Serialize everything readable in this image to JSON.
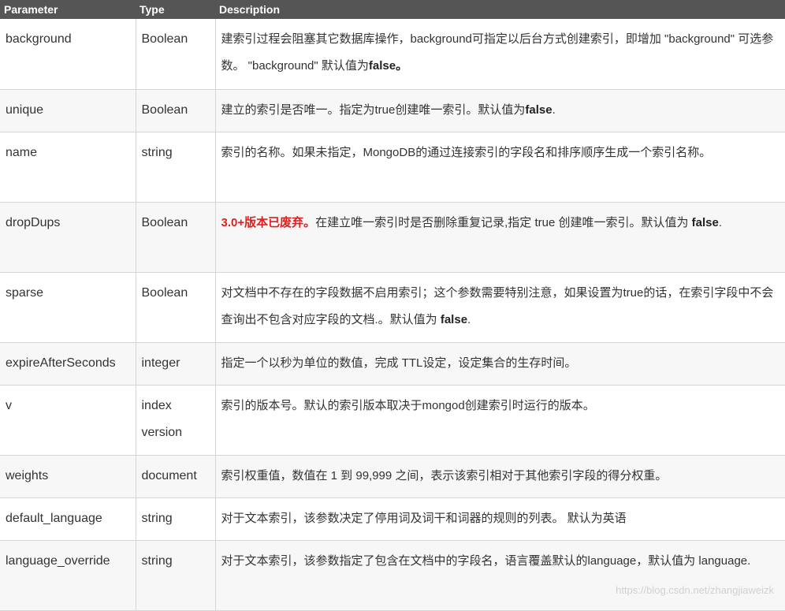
{
  "headers": {
    "parameter": "Parameter",
    "type": "Type",
    "description": "Description"
  },
  "rows": [
    {
      "param": "background",
      "type": "Boolean",
      "desc_a": "建索引过程会阻塞其它数据库操作，background可指定以后台方式创建索引，即增加 \"background\" 可选参数。 \"background\" 默认值为",
      "desc_bold": "false。",
      "desc_b": ""
    },
    {
      "param": "unique",
      "type": "Boolean",
      "desc_a": "建立的索引是否唯一。指定为true创建唯一索引。默认值为",
      "desc_bold": "false",
      "desc_b": "."
    },
    {
      "param": "name",
      "type": "string",
      "desc_a": "索引的名称。如果未指定，MongoDB的通过连接索引的字段名和排序顺序生成一个索引名称。",
      "desc_bold": "",
      "desc_b": ""
    },
    {
      "param": "dropDups",
      "type": "Boolean",
      "desc_warn": "3.0+版本已废弃。",
      "desc_a": "在建立唯一索引时是否删除重复记录,指定 true 创建唯一索引。默认值为 ",
      "desc_bold": "false",
      "desc_b": "."
    },
    {
      "param": "sparse",
      "type": "Boolean",
      "desc_a": "对文档中不存在的字段数据不启用索引；这个参数需要特别注意，如果设置为true的话，在索引字段中不会查询出不包含对应字段的文档.。默认值为 ",
      "desc_bold": "false",
      "desc_b": "."
    },
    {
      "param": "expireAfterSeconds",
      "type": "integer",
      "desc_a": "指定一个以秒为单位的数值，完成 TTL设定，设定集合的生存时间。",
      "desc_bold": "",
      "desc_b": ""
    },
    {
      "param": "v",
      "type": "index version",
      "desc_a": "索引的版本号。默认的索引版本取决于mongod创建索引时运行的版本。",
      "desc_bold": "",
      "desc_b": ""
    },
    {
      "param": "weights",
      "type": "document",
      "desc_a": "索引权重值，数值在 1 到 99,999 之间，表示该索引相对于其他索引字段的得分权重。",
      "desc_bold": "",
      "desc_b": ""
    },
    {
      "param": "default_language",
      "type": "string",
      "desc_a": "对于文本索引，该参数决定了停用词及词干和词器的规则的列表。 默认为英语",
      "desc_bold": "",
      "desc_b": ""
    },
    {
      "param": "language_override",
      "type": "string",
      "desc_a": "对于文本索引，该参数指定了包含在文档中的字段名，语言覆盖默认的language，默认值为 language.",
      "desc_bold": "",
      "desc_b": ""
    }
  ],
  "watermark": "https://blog.csdn.net/zhangjiaweizk"
}
